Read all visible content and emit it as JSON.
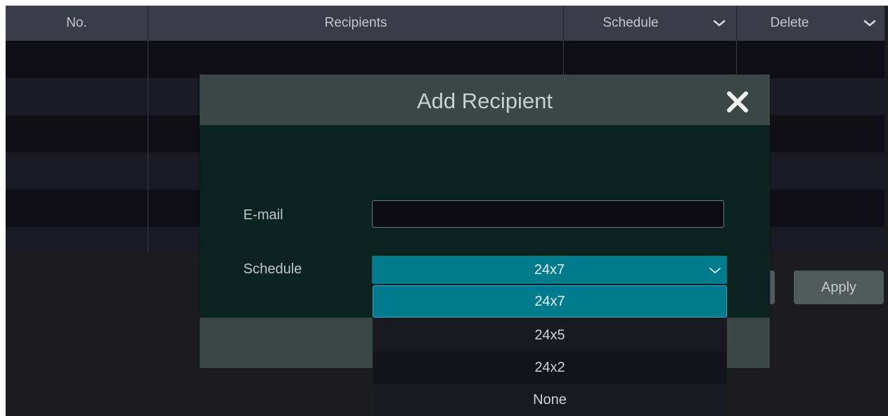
{
  "table": {
    "columns": {
      "no": "No.",
      "recipients": "Recipients",
      "schedule": "Schedule",
      "delete": "Delete"
    },
    "rows": []
  },
  "buttons": {
    "apply": "Apply"
  },
  "dialog": {
    "title": "Add Recipient",
    "email_label": "E-mail",
    "email_value": "",
    "schedule_label": "Schedule",
    "schedule_selected": "24x7",
    "schedule_options": [
      "24x7",
      "24x5",
      "24x2",
      "None"
    ]
  },
  "icons": {
    "close": "close-icon",
    "dropdown": "chevron-down-icon"
  },
  "colors": {
    "accent": "#007b8e",
    "header_bg": "#3a3d47",
    "dialog_header": "#3a4744",
    "dialog_body": "#0b2320"
  }
}
